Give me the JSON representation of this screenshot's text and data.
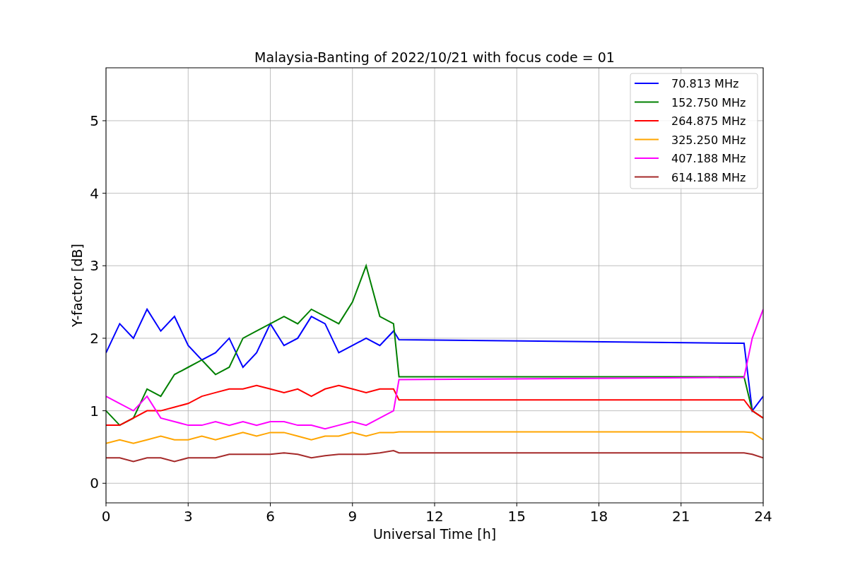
{
  "chart_data": {
    "type": "line",
    "title": "Malaysia-Banting of 2022/10/21 with focus code = 01",
    "xlabel": "Universal Time [h]",
    "ylabel": "Y-factor [dB]",
    "x": [
      0,
      0.5,
      1,
      1.5,
      2,
      2.5,
      3,
      3.5,
      4,
      4.5,
      5,
      5.5,
      6,
      6.5,
      7,
      7.5,
      8,
      8.5,
      9,
      9.5,
      10,
      10.5,
      10.7,
      23.3,
      23.6,
      24
    ],
    "series": [
      {
        "name": "70.813 MHz",
        "color": "#0000ff",
        "values": [
          1.8,
          2.2,
          2.0,
          2.4,
          2.1,
          2.3,
          1.9,
          1.7,
          1.8,
          2.0,
          1.6,
          1.8,
          2.2,
          1.9,
          2.0,
          2.3,
          2.2,
          1.8,
          1.9,
          2.0,
          1.9,
          2.1,
          1.98,
          1.93,
          1.0,
          1.2
        ]
      },
      {
        "name": "152.750 MHz",
        "color": "#008000",
        "values": [
          1.0,
          0.8,
          0.9,
          1.3,
          1.2,
          1.5,
          1.6,
          1.7,
          1.5,
          1.6,
          2.0,
          2.1,
          2.2,
          2.3,
          2.2,
          2.4,
          2.3,
          2.2,
          2.5,
          3.0,
          2.3,
          2.2,
          1.47,
          1.47,
          1.0,
          0.9
        ]
      },
      {
        "name": "264.875 MHz",
        "color": "#ff0000",
        "values": [
          0.8,
          0.8,
          0.9,
          1.0,
          1.0,
          1.05,
          1.1,
          1.2,
          1.25,
          1.3,
          1.3,
          1.35,
          1.3,
          1.25,
          1.3,
          1.2,
          1.3,
          1.35,
          1.3,
          1.25,
          1.3,
          1.3,
          1.15,
          1.15,
          1.0,
          0.9
        ]
      },
      {
        "name": "325.250 MHz",
        "color": "#ffa500",
        "values": [
          0.55,
          0.6,
          0.55,
          0.6,
          0.65,
          0.6,
          0.6,
          0.65,
          0.6,
          0.65,
          0.7,
          0.65,
          0.7,
          0.7,
          0.65,
          0.6,
          0.65,
          0.65,
          0.7,
          0.65,
          0.7,
          0.7,
          0.71,
          0.71,
          0.7,
          0.6
        ]
      },
      {
        "name": "407.188 MHz",
        "color": "#ff00ff",
        "values": [
          1.2,
          1.1,
          1.0,
          1.2,
          0.9,
          0.85,
          0.8,
          0.8,
          0.85,
          0.8,
          0.85,
          0.8,
          0.85,
          0.85,
          0.8,
          0.8,
          0.75,
          0.8,
          0.85,
          0.8,
          0.9,
          1.0,
          1.43,
          1.46,
          2.0,
          2.4
        ]
      },
      {
        "name": "614.188 MHz",
        "color": "#a52a2a",
        "values": [
          0.35,
          0.35,
          0.3,
          0.35,
          0.35,
          0.3,
          0.35,
          0.35,
          0.35,
          0.4,
          0.4,
          0.4,
          0.4,
          0.42,
          0.4,
          0.35,
          0.38,
          0.4,
          0.4,
          0.4,
          0.42,
          0.45,
          0.42,
          0.42,
          0.4,
          0.35
        ]
      }
    ],
    "xlim": [
      0,
      24
    ],
    "ylim": [
      -0.27,
      5.73
    ],
    "xticks": [
      0,
      3,
      6,
      9,
      12,
      15,
      18,
      21,
      24
    ],
    "yticks": [
      0,
      1,
      2,
      3,
      4,
      5
    ],
    "grid": true,
    "legend": true
  }
}
